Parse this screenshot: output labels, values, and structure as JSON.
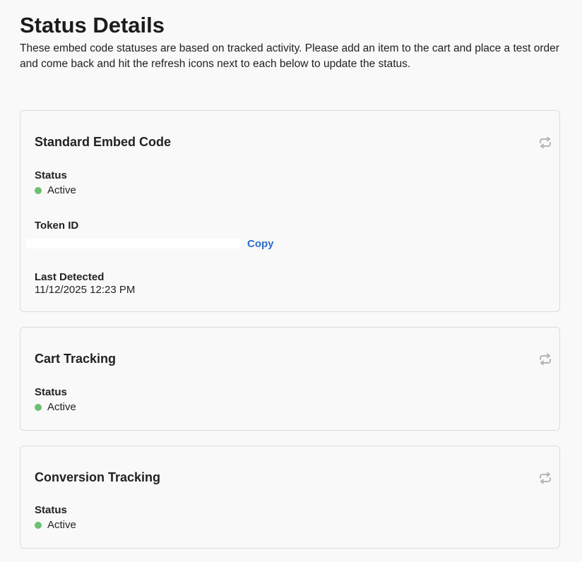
{
  "page": {
    "title": "Status Details",
    "description": "These embed code statuses are based on tracked activity. Please add an item to the cart and place a test order and come back and hit the refresh icons next to each below to update the status."
  },
  "cards": [
    {
      "title": "Standard Embed Code",
      "status_label": "Status",
      "status_value": "Active",
      "token_label": "Token ID",
      "copy_label": "Copy",
      "last_detected_label": "Last Detected",
      "last_detected_value": "11/12/2025 12:23 PM"
    },
    {
      "title": "Cart Tracking",
      "status_label": "Status",
      "status_value": "Active"
    },
    {
      "title": "Conversion Tracking",
      "status_label": "Status",
      "status_value": "Active"
    }
  ],
  "icons": {
    "refresh": "refresh-icon"
  },
  "colors": {
    "status_active": "#6cc070",
    "link": "#2c6ecb",
    "icon": "#b5b5b5"
  }
}
